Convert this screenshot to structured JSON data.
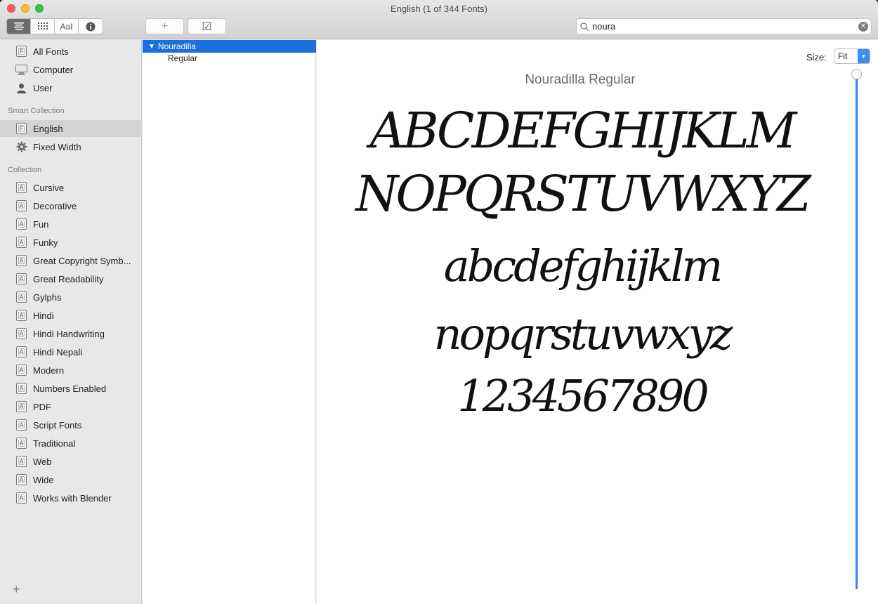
{
  "window": {
    "title": "English (1 of 344 Fonts)"
  },
  "toolbar": {
    "view_buttons": [
      {
        "icon": "list-view-icon",
        "active": true
      },
      {
        "icon": "grid-view-icon",
        "active": false
      },
      {
        "label": "AaI",
        "icon": "sample-view-icon",
        "active": false
      },
      {
        "icon": "info-icon",
        "active": false
      }
    ],
    "add_label": "+",
    "validate_label": "☑",
    "search": {
      "value": "noura",
      "placeholder": ""
    }
  },
  "sidebar": {
    "library_items": [
      {
        "label": "All Fonts",
        "icon": "font-library-icon"
      },
      {
        "label": "Computer",
        "icon": "computer-icon"
      },
      {
        "label": "User",
        "icon": "user-icon"
      }
    ],
    "smart_collection_header": "Smart Collection",
    "smart_collections": [
      {
        "label": "English",
        "icon": "font-library-icon",
        "selected": true
      },
      {
        "label": "Fixed Width",
        "icon": "gear-icon",
        "selected": false
      }
    ],
    "collection_header": "Collection",
    "collections": [
      {
        "label": "Cursive"
      },
      {
        "label": "Decorative"
      },
      {
        "label": "Fun"
      },
      {
        "label": "Funky"
      },
      {
        "label": "Great Copyright Symb..."
      },
      {
        "label": "Great Readability"
      },
      {
        "label": "Gylphs"
      },
      {
        "label": "Hindi"
      },
      {
        "label": "Hindi Handwriting"
      },
      {
        "label": "Hindi Nepali"
      },
      {
        "label": "Modern"
      },
      {
        "label": "Numbers Enabled"
      },
      {
        "label": "PDF"
      },
      {
        "label": "Script Fonts"
      },
      {
        "label": "Traditional"
      },
      {
        "label": "Web"
      },
      {
        "label": "Wide"
      },
      {
        "label": "Works with Blender"
      }
    ],
    "add_label": "+"
  },
  "font_list": {
    "family": "Nouradilla",
    "faces": [
      "Regular"
    ]
  },
  "preview": {
    "size_label": "Size:",
    "size_value": "Fit",
    "font_name": "Nouradilla Regular",
    "samples": [
      "ABCDEFGHIJKLM",
      "NOPQRSTUVWXYZ",
      "abcdefghijklm",
      "nopqrstuvwxyz",
      "1234567890"
    ],
    "size_slider_fraction": 1.0
  },
  "colors": {
    "selection": "#1a6fdc",
    "slider": "#3187ee",
    "close": "#fc5f57",
    "minimize": "#fdbc2e",
    "maximize": "#33c748"
  }
}
